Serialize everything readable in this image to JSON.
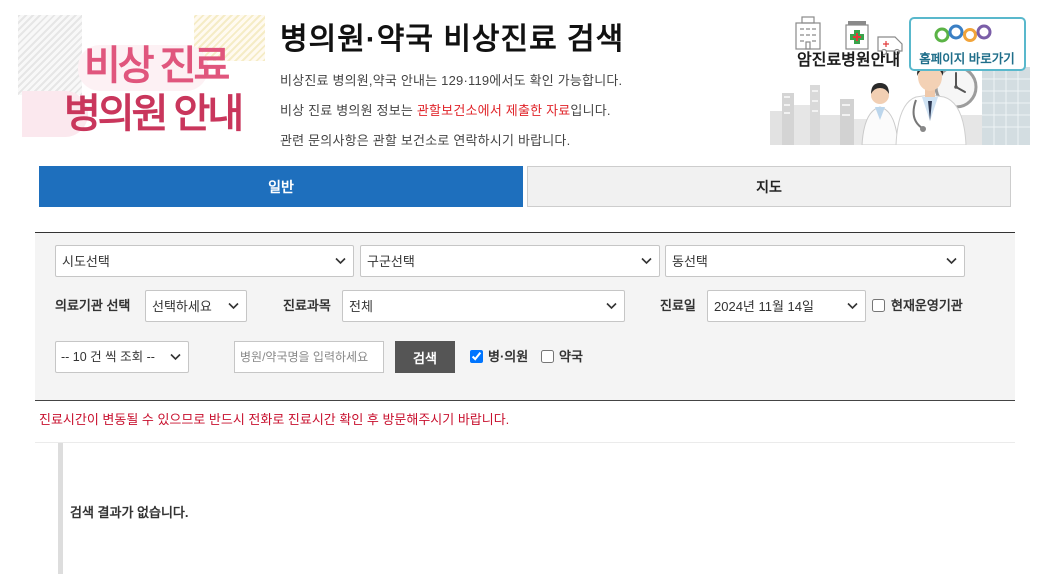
{
  "header": {
    "logo": {
      "line1": "비상 진료",
      "line2": "병의원 안내"
    },
    "title": "병의원·약국 비상진료 검색",
    "info": [
      {
        "text": "비상진료 병의원,약국 안내는 129·119에서도 확인 가능합니다."
      },
      {
        "before": "비상 진료 병의원 정보는 ",
        "highlight": "관할보건소에서 제출한 자료",
        "after": "입니다."
      },
      {
        "text": "관련 문의사항은 관할 보건소로 연락하시기 바랍니다."
      }
    ],
    "banner": {
      "label": "암진료병원안내",
      "homepage_link": "홈페이지 바로가기"
    }
  },
  "tabs": [
    {
      "label": "일반",
      "active": true
    },
    {
      "label": "지도",
      "active": false
    }
  ],
  "search": {
    "sido": {
      "selected": "시도선택"
    },
    "gugun": {
      "selected": "구군선택"
    },
    "dong": {
      "selected": "동선택"
    },
    "institution": {
      "label": "의료기관 선택",
      "selected": "선택하세요"
    },
    "department": {
      "label": "진료과목",
      "selected": "전체"
    },
    "date": {
      "label": "진료일",
      "selected": "2024년 11월 14일"
    },
    "open_now": {
      "label": "현재운영기관",
      "checked": false
    },
    "page_size": {
      "selected": "-- 10 건 씩 조회 --"
    },
    "keyword": {
      "placeholder": "병원/약국명을 입력하세요",
      "value": ""
    },
    "search_button": "검색",
    "type_hospital": {
      "label": "병·의원",
      "checked": true
    },
    "type_pharmacy": {
      "label": "약국",
      "checked": false
    }
  },
  "notice": "진료시간이 변동될 수 있으므로 반드시 전화로 진료시간 확인 후 방문해주시기 바랍니다.",
  "results": {
    "empty_message": "검색 결과가 없습니다."
  },
  "colors": {
    "primary_tab": "#1e6fbd",
    "highlight_red": "#e0242a",
    "notice_red": "#c8102e",
    "logo_pink": "#e0567d",
    "logo_rose": "#c9365c",
    "search_button": "#555555",
    "egen_border": "#59b8cc"
  },
  "icons": {
    "select_dropdown": "chevron-down-icon",
    "banner": [
      "hospital-building-icon",
      "clinic-cross-icon",
      "ambulance-icon",
      "wall-clock-icon",
      "egen-logo"
    ]
  }
}
